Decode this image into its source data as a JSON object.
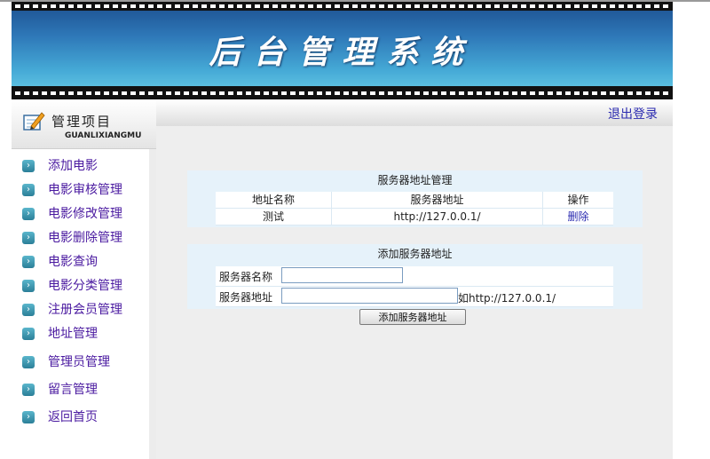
{
  "header": {
    "title": "后台管理系统"
  },
  "sidebar": {
    "title": "管理项目",
    "subtitle": "GUANLIXIANGMU",
    "items": [
      {
        "label": "添加电影"
      },
      {
        "label": "电影审核管理"
      },
      {
        "label": "电影修改管理"
      },
      {
        "label": "电影删除管理"
      },
      {
        "label": "电影查询"
      },
      {
        "label": "电影分类管理"
      },
      {
        "label": "注册会员管理"
      },
      {
        "label": "地址管理"
      },
      {
        "label": "管理员管理"
      },
      {
        "label": "留言管理"
      },
      {
        "label": "返回首页"
      }
    ]
  },
  "topbar": {
    "logout_label": "退出登录"
  },
  "server_list": {
    "title": "服务器地址管理",
    "columns": [
      "地址名称",
      "服务器地址",
      "操作"
    ],
    "rows": [
      {
        "name": "测试",
        "address": "http://127.0.0.1/",
        "action": "删除"
      }
    ]
  },
  "add_server": {
    "title": "添加服务器地址",
    "name_label": "服务器名称",
    "name_value": "",
    "address_label": "服务器地址",
    "address_value": "",
    "address_hint": "如http://127.0.0.1/",
    "submit_label": "添加服务器地址"
  },
  "colors": {
    "banner": "#2e78b8",
    "link": "#2b2bb0",
    "menu_text": "#4a1aa0",
    "panel": "#e6f2fa"
  }
}
